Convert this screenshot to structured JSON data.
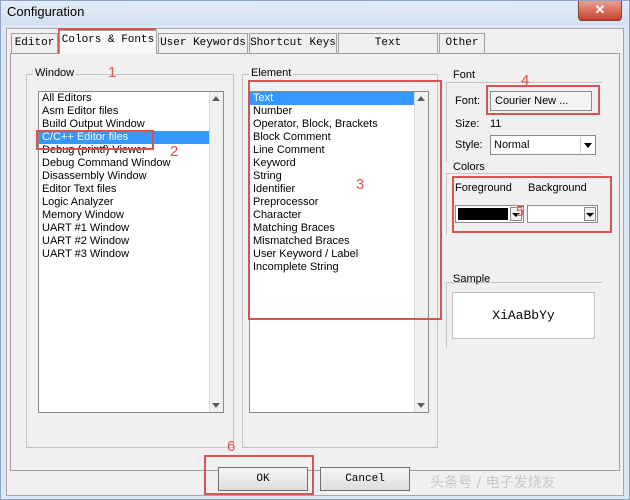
{
  "window": {
    "title": "Configuration",
    "close_glyph": "✕"
  },
  "tabs": [
    {
      "label": "Editor"
    },
    {
      "label": "Colors & Fonts"
    },
    {
      "label": "User Keywords"
    },
    {
      "label": "Shortcut Keys"
    },
    {
      "label": "Text Completion"
    },
    {
      "label": "Other"
    }
  ],
  "window_group": {
    "label": "Window",
    "items": [
      "All Editors",
      "Asm Editor files",
      "Build Output Window",
      "C/C++ Editor files",
      "Debug (printf) Viewer",
      "Debug Command Window",
      "Disassembly Window",
      "Editor Text files",
      "Logic Analyzer",
      "Memory Window",
      "UART #1 Window",
      "UART #2 Window",
      "UART #3 Window"
    ],
    "selected": "C/C++ Editor files"
  },
  "element_group": {
    "label": "Element",
    "items": [
      "Text",
      "Number",
      "Operator, Block, Brackets",
      "Block Comment",
      "Line Comment",
      "Keyword",
      "String",
      "Identifier",
      "Preprocessor",
      "Character",
      "Matching Braces",
      "Mismatched Braces",
      "User Keyword / Label",
      "Incomplete String"
    ],
    "selected": "Text"
  },
  "font_group": {
    "label": "Font",
    "font_label": "Font:",
    "font_value": "Courier New ...",
    "size_label": "Size:",
    "size_value": "11",
    "style_label": "Style:",
    "style_value": "Normal"
  },
  "colors_group": {
    "label": "Colors",
    "foreground_label": "Foreground",
    "background_label": "Background",
    "foreground_color": "#000000",
    "background_color": "#ffffff"
  },
  "sample_group": {
    "label": "Sample",
    "text": "XiAaBbYy"
  },
  "buttons": {
    "ok": "OK",
    "cancel": "Cancel"
  },
  "annotations": [
    "1",
    "2",
    "3",
    "4",
    "5",
    "6"
  ],
  "watermark": "头条号 / 电子发烧友"
}
